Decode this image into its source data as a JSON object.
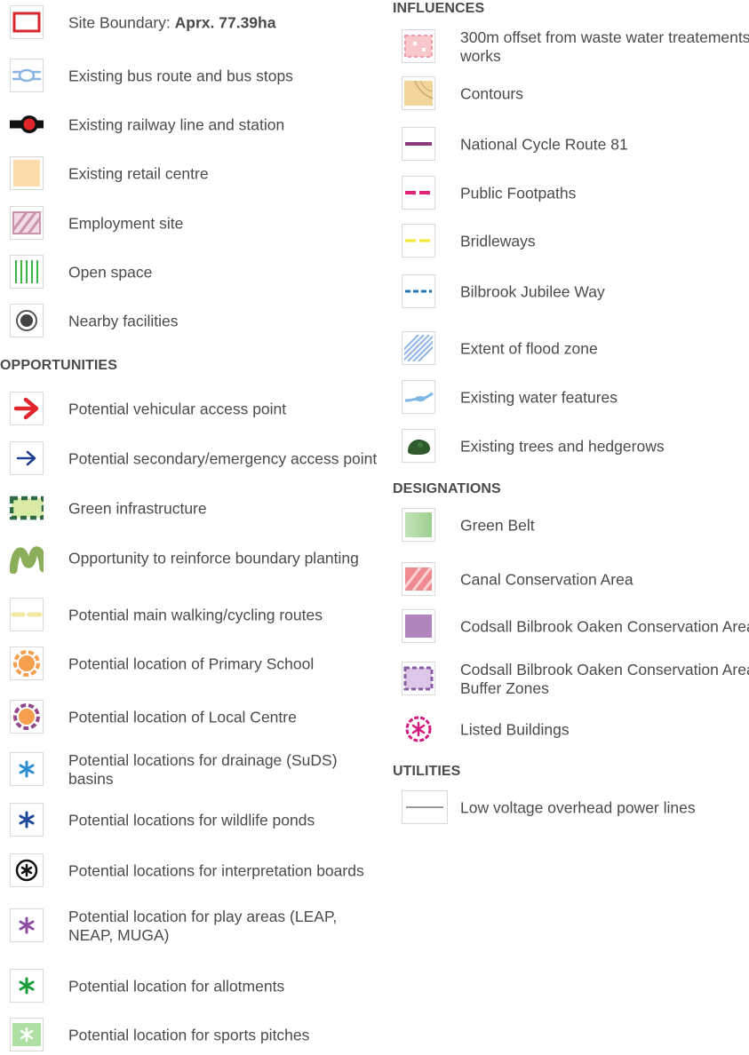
{
  "headings": {
    "opportunities": "OPPORTUNITIES",
    "influences": "INFLUENCES",
    "designations": "DESIGNATIONS",
    "utilities": "UTILITIES"
  },
  "general": [
    {
      "icon": "site-boundary-icon",
      "label": "Site Boundary: ",
      "label_bold": "Aprx. 77.39ha"
    },
    {
      "icon": "bus-route-icon",
      "label": "Existing bus route and bus stops"
    },
    {
      "icon": "railway-station-icon",
      "label": "Existing railway line and station"
    },
    {
      "icon": "retail-centre-icon",
      "label": "Existing retail centre"
    },
    {
      "icon": "employment-site-icon",
      "label": "Employment site"
    },
    {
      "icon": "open-space-icon",
      "label": "Open space"
    },
    {
      "icon": "nearby-facilities-icon",
      "label": "Nearby facilities"
    }
  ],
  "opportunities": [
    {
      "icon": "vehicular-access-arrow-icon",
      "label": "Potential vehicular access point"
    },
    {
      "icon": "secondary-access-arrow-icon",
      "label": "Potential secondary/emergency access point"
    },
    {
      "icon": "green-infrastructure-icon",
      "label": "Green infrastructure"
    },
    {
      "icon": "boundary-planting-icon",
      "label": "Opportunity to reinforce boundary planting"
    },
    {
      "icon": "walking-cycling-route-icon",
      "label": "Potential main walking/cycling routes"
    },
    {
      "icon": "primary-school-icon",
      "label": "Potential location of Primary School"
    },
    {
      "icon": "local-centre-icon",
      "label": "Potential location of Local Centre"
    },
    {
      "icon": "drainage-basin-asterisk-icon",
      "label": "Potential locations for drainage (SuDS) basins"
    },
    {
      "icon": "wildlife-pond-asterisk-icon",
      "label": "Potential locations for wildlife ponds"
    },
    {
      "icon": "interpretation-board-icon",
      "label": "Potential locations for interpretation boards"
    },
    {
      "icon": "play-area-asterisk-icon",
      "label": "Potential location for play areas (LEAP, NEAP, MUGA)"
    },
    {
      "icon": "allotment-asterisk-icon",
      "label": "Potential location for allotments"
    },
    {
      "icon": "sports-pitch-icon",
      "label": "Potential location for sports pitches"
    }
  ],
  "influences": [
    {
      "icon": "waste-water-offset-icon",
      "label": "300m offset from waste water treatements works"
    },
    {
      "icon": "contours-icon",
      "label": "Contours"
    },
    {
      "icon": "cycle-route-line-icon",
      "label": "National Cycle Route 81"
    },
    {
      "icon": "footpath-line-icon",
      "label": "Public Footpaths"
    },
    {
      "icon": "bridleway-line-icon",
      "label": "Bridleways"
    },
    {
      "icon": "jubilee-way-line-icon",
      "label": "Bilbrook Jubilee Way"
    },
    {
      "icon": "flood-zone-hatch-icon",
      "label": "Extent of flood zone"
    },
    {
      "icon": "water-feature-icon",
      "label": "Existing water features"
    },
    {
      "icon": "trees-hedgerows-icon",
      "label": "Existing trees and hedgerows"
    }
  ],
  "designations": [
    {
      "icon": "green-belt-icon",
      "label": "Green Belt"
    },
    {
      "icon": "canal-conservation-icon",
      "label": "Canal Conservation Area"
    },
    {
      "icon": "conservation-area-icon",
      "label": "Codsall Bilbrook Oaken Conservation Area"
    },
    {
      "icon": "conservation-buffer-icon",
      "label": "Codsall Bilbrook Oaken Conservation Area Buffer Zones"
    },
    {
      "icon": "listed-building-icon",
      "label": "Listed Buildings"
    }
  ],
  "utilities": [
    {
      "icon": "power-line-icon",
      "label": "Low voltage overhead power lines"
    }
  ],
  "colors": {
    "text": "#4b4b4b",
    "site_boundary": "#d7262e",
    "bus": "#8ab5e2",
    "retail": "#fbdcaa",
    "employment": "#c992ad",
    "open_space": "#3bb54a",
    "vehicular_arrow": "#e0262a",
    "secondary_arrow": "#1e3f8f",
    "green_infra": "#2e6b45",
    "boundary_planting": "#8bae5b",
    "walking_cycling": "#f3eaa0",
    "school": "#f6a04d",
    "local_centre": "#93498b",
    "drainage": "#2c8ed0",
    "wildlife_pond": "#1d4b99",
    "play_area": "#8e4fa2",
    "allotment": "#1a9d3b",
    "sports_pitch": "#aee0a3",
    "waste_water": "#f29aa3",
    "contours": "#e8c587",
    "cycle_route": "#8a3b79",
    "footpath": "#e5217b",
    "bridleway": "#f4e92a",
    "jubilee_way": "#2273b8",
    "flood_zone": "#8ab5e6",
    "water_feature": "#7eb7e5",
    "trees": "#2e5a2e",
    "green_belt": "#a8d69b",
    "canal_conservation": "#ee8a90",
    "conservation_area": "#b184be",
    "conservation_buffer": "#8a5aa6",
    "listed_building": "#d21a7f",
    "power_line": "#999999"
  }
}
